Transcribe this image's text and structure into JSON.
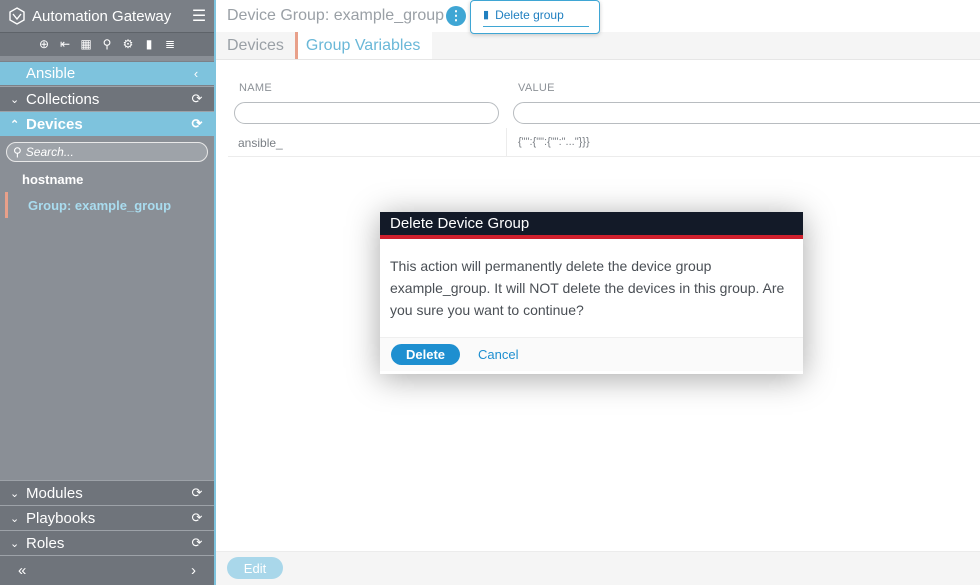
{
  "app": {
    "title": "Automation Gateway",
    "menu_icon": "hamburger-icon"
  },
  "toolbar": {
    "icons": [
      "add-icon",
      "logout-icon",
      "grid-icon",
      "search-icon",
      "gear-icon",
      "file-icon",
      "list-icon"
    ]
  },
  "sidebar": {
    "ansible_label": "Ansible",
    "sections": {
      "collections": "Collections",
      "devices": "Devices",
      "modules": "Modules",
      "playbooks": "Playbooks",
      "roles": "Roles"
    },
    "search_placeholder": "Search...",
    "device_items": [
      "hostname",
      "Group: example_group"
    ],
    "footer_left": "«",
    "footer_right": "›"
  },
  "header": {
    "title": "Device Group: example_group",
    "popover_item": "Delete group"
  },
  "tabs": [
    "Devices",
    "Group Variables"
  ],
  "table": {
    "columns": [
      "NAME",
      "VALUE"
    ],
    "rows": [
      {
        "name": "ansible_",
        "value": "{\"\":{\"\":{\"\":\"...\"}}}"
      }
    ]
  },
  "footer": {
    "edit_label": "Edit"
  },
  "modal": {
    "title": "Delete Device Group",
    "body": "This action will permanently delete the device group example_group. It will NOT delete the devices in this group. Are you sure you want to continue?",
    "confirm_label": "Delete",
    "cancel_label": "Cancel"
  },
  "colors": {
    "accent": "#7ec3dd",
    "primary": "#1e8fd0",
    "danger": "#d0202d",
    "sidebar": "#8a8f96",
    "modal_header": "#131a28"
  }
}
